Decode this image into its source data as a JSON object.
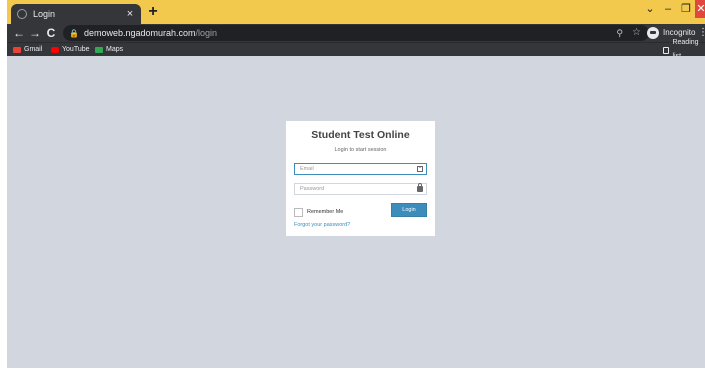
{
  "browser": {
    "tab": {
      "title": "Login",
      "close_glyph": "×"
    },
    "new_tab_glyph": "+",
    "window_controls": {
      "tab_list": "⌄",
      "minimize": "–",
      "maximize": "❐",
      "close": "✕"
    },
    "nav": {
      "back": "←",
      "forward": "→",
      "reload": "C"
    },
    "address": {
      "host": "demoweb.ngadomurah.com",
      "path": "/login",
      "lock_glyph": "🔒",
      "zoom_glyph": "⚲",
      "star_glyph": "☆"
    },
    "profile": {
      "label": "Incognito"
    },
    "menu_glyph": "⋮",
    "bookmarks": [
      {
        "label": "Gmail",
        "icon": "gmail-icon"
      },
      {
        "label": "YouTube",
        "icon": "youtube-icon"
      },
      {
        "label": "Maps",
        "icon": "maps-icon"
      }
    ],
    "reading_list": "Reading list",
    "colors": {
      "tab_strip": "#f2c94c",
      "toolbar": "#35363a",
      "close": "#e0483e"
    }
  },
  "login": {
    "title": "Student Test Online",
    "message": "Login to start session",
    "email_placeholder": "Email",
    "email_value": "",
    "password_placeholder": "Password",
    "password_value": "",
    "remember_label": "Remember Me",
    "remember_checked": false,
    "login_button": "Login",
    "forgot_link": "Forgot your password?",
    "colors": {
      "accent": "#3c8dbc",
      "page_bg": "#d2d6de"
    }
  }
}
